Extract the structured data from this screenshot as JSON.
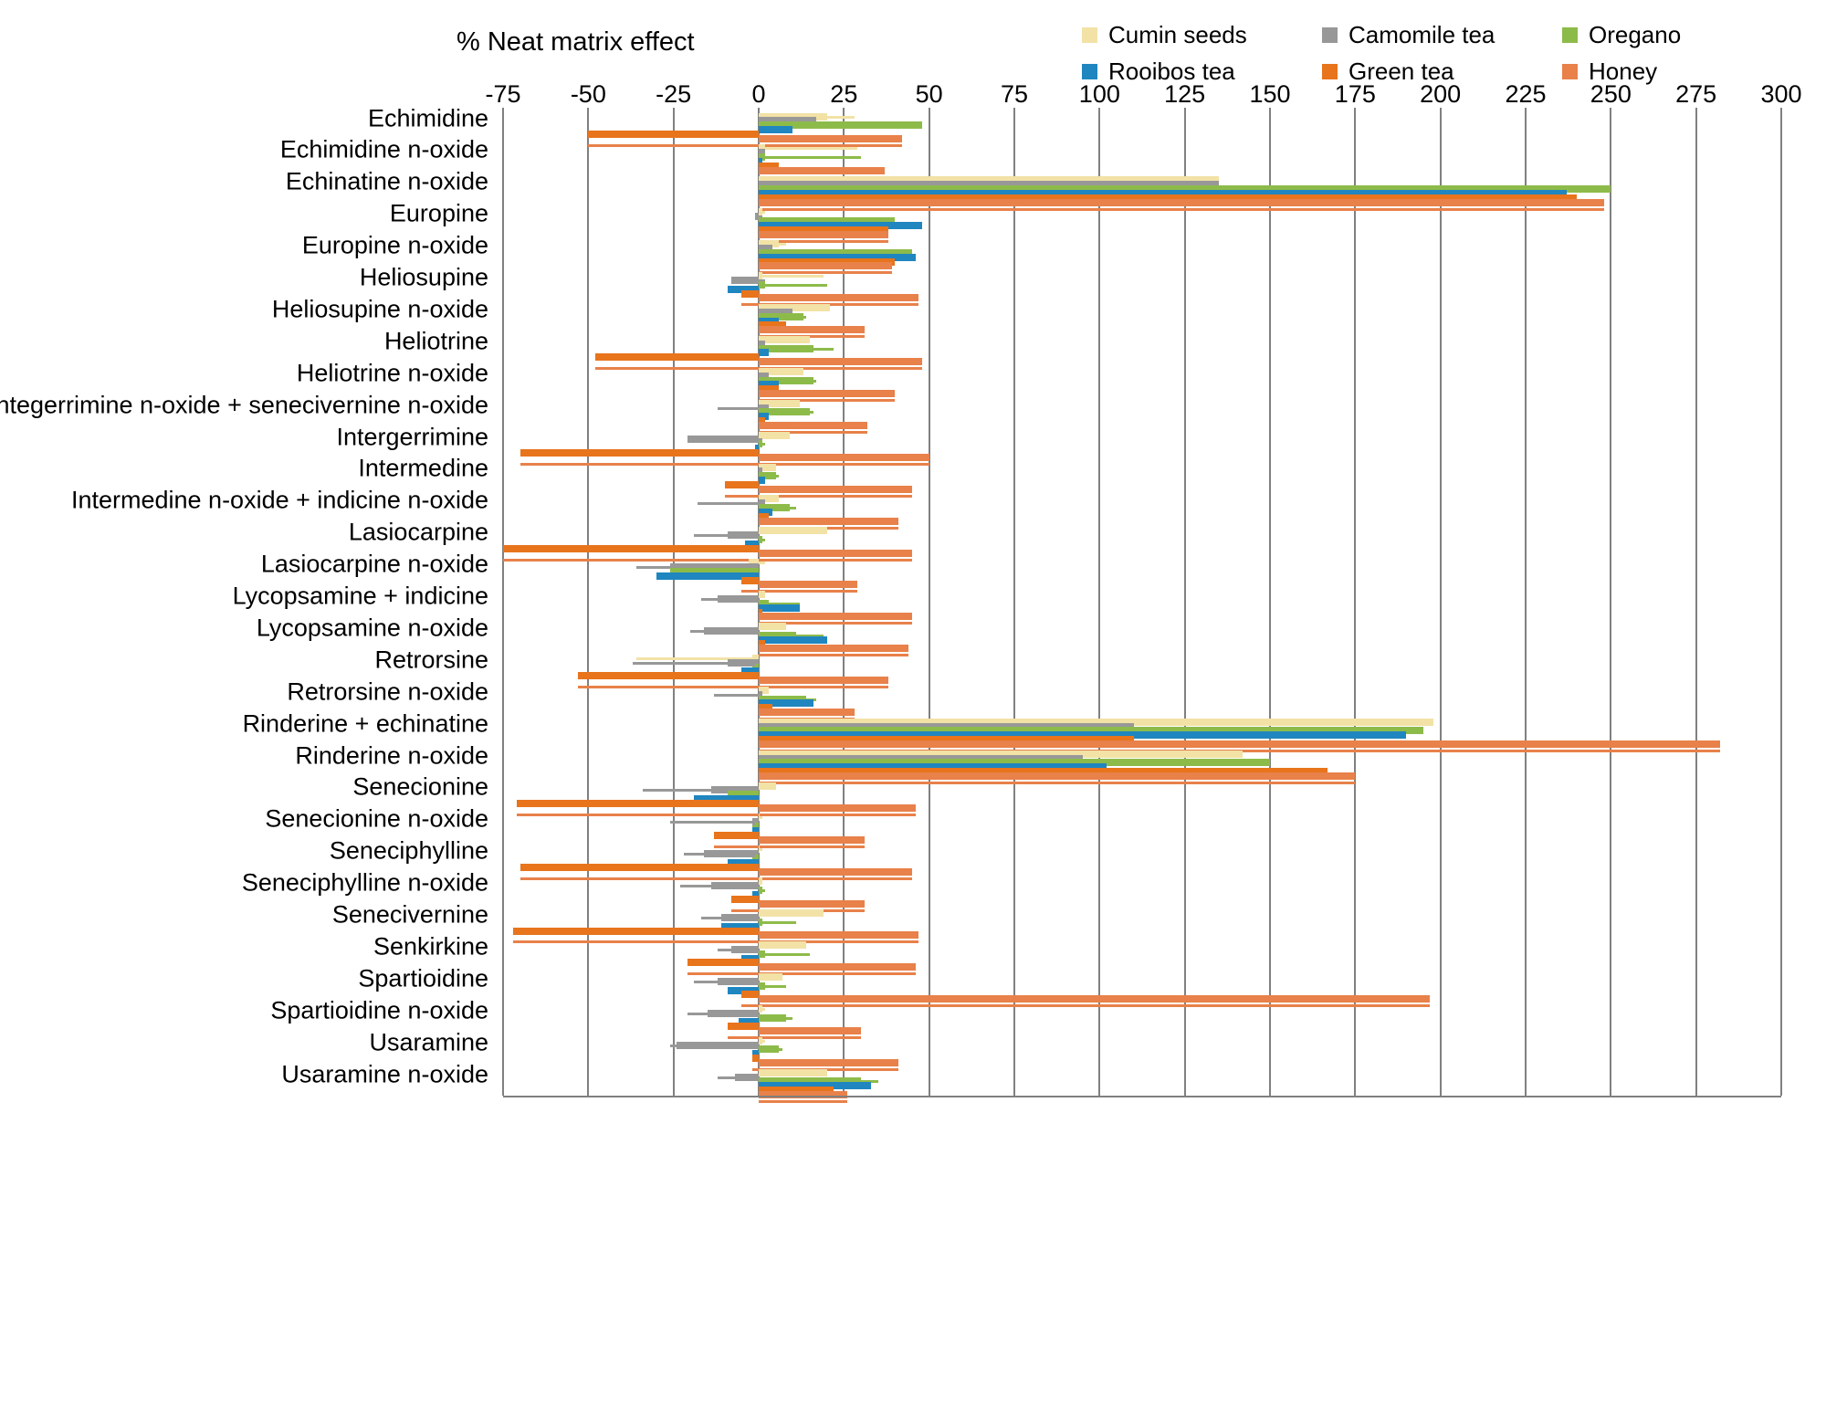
{
  "chart_data": {
    "type": "bar",
    "orientation": "horizontal",
    "title": "% Neat matrix effect",
    "xlabel": "% Neat matrix effect",
    "ylabel": "",
    "xlim": [
      -75,
      300
    ],
    "xticks": [
      -75,
      -50,
      -25,
      0,
      25,
      50,
      75,
      100,
      125,
      150,
      175,
      200,
      225,
      250,
      275,
      300
    ],
    "grid": true,
    "legend_position": "top-right",
    "colors": {
      "Cumin seeds": "#F2E2A6",
      "Camomile tea": "#989898",
      "Oregano": "#8DBB4A",
      "Rooibos tea": "#1F86C0",
      "Green tea": "#E8741C",
      "Honey": "#E8814A"
    },
    "series_names": [
      "Cumin seeds",
      "Camomile tea",
      "Oregano",
      "Rooibos tea",
      "Green tea",
      "Honey"
    ],
    "categories": [
      "Echimidine",
      "Echimidine n-oxide",
      "Echinatine n-oxide",
      "Europine",
      "Europine n-oxide",
      "Heliosupine",
      "Heliosupine n-oxide",
      "Heliotrine",
      "Heliotrine n-oxide",
      "Integerrimine n-oxide + senecivernine n-oxide",
      "Intergerrimine",
      "Intermedine",
      "Intermedine n-oxide + indicine n-oxide",
      "Lasiocarpine",
      "Lasiocarpine n-oxide",
      "Lycopsamine + indicine",
      "Lycopsamine n-oxide",
      "Retrorsine",
      "Retrorsine n-oxide",
      "Rinderine + echinatine",
      "Rinderine n-oxide",
      "Senecionine",
      "Senecionine n-oxide",
      "Seneciphylline",
      "Seneciphylline n-oxide",
      "Senecivernine",
      "Senkirkine",
      "Spartioidine",
      "Spartioidine n-oxide",
      "Usaramine",
      "Usaramine n-oxide"
    ],
    "series": [
      {
        "name": "Cumin seeds",
        "values": [
          20,
          2,
          135,
          1,
          6,
          1,
          21,
          15,
          13,
          12,
          9,
          5,
          6,
          20,
          -3,
          2,
          8,
          -2,
          3,
          198,
          142,
          5,
          0,
          0,
          1,
          19,
          14,
          7,
          1,
          1,
          20
        ],
        "errors": [
          28,
          29,
          95,
          2,
          8,
          19,
          4,
          2,
          3,
          3,
          1,
          2,
          5,
          3,
          2,
          2,
          4,
          -36,
          2,
          5,
          7,
          3,
          1,
          1,
          1,
          2,
          2,
          2,
          2,
          2,
          4
        ]
      },
      {
        "name": "Camomile tea",
        "values": [
          17,
          2,
          135,
          -1,
          4,
          -8,
          10,
          2,
          3,
          3,
          -21,
          1,
          2,
          -9,
          -26,
          -12,
          -16,
          -9,
          1,
          110,
          95,
          -14,
          -2,
          -16,
          -14,
          -11,
          -8,
          -12,
          -15,
          -24,
          -7
        ],
        "errors": [
          1,
          1,
          4,
          1,
          1,
          2,
          1,
          1,
          1,
          -12,
          1,
          1,
          -18,
          -19,
          -36,
          -17,
          -20,
          -37,
          -13,
          3,
          3,
          -34,
          -26,
          -22,
          -23,
          -17,
          -12,
          -19,
          -21,
          -26,
          -12
        ]
      },
      {
        "name": "Oregano",
        "values": [
          48,
          2,
          250,
          40,
          45,
          2,
          13,
          16,
          16,
          15,
          1,
          5,
          9,
          1,
          -26,
          3,
          11,
          -1,
          14,
          195,
          150,
          -9,
          -1,
          -1,
          1,
          1,
          2,
          2,
          8,
          6,
          30
        ],
        "errors": [
          48,
          30,
          250,
          40,
          45,
          20,
          14,
          22,
          17,
          16,
          2,
          6,
          11,
          2,
          -25,
          12,
          19,
          -2,
          17,
          195,
          150,
          -8,
          -2,
          -2,
          2,
          11,
          15,
          8,
          10,
          7,
          35
        ]
      },
      {
        "name": "Rooibos tea",
        "values": [
          10,
          1,
          237,
          48,
          46,
          -9,
          6,
          3,
          6,
          3,
          -1,
          2,
          4,
          -4,
          -30,
          12,
          20,
          -5,
          16,
          190,
          102,
          -19,
          -2,
          -9,
          -2,
          -11,
          -5,
          -9,
          -6,
          -2,
          33
        ]
      },
      {
        "name": "Green tea",
        "values": [
          -50,
          6,
          240,
          38,
          40,
          -5,
          8,
          -48,
          6,
          2,
          -70,
          -10,
          3,
          -75,
          -5,
          1,
          2,
          -53,
          4,
          110,
          167,
          -71,
          -13,
          -70,
          -8,
          -72,
          -21,
          -5,
          -9,
          -2,
          22
        ]
      },
      {
        "name": "Honey",
        "values": [
          42,
          37,
          248,
          38,
          39,
          47,
          31,
          48,
          40,
          32,
          50,
          45,
          41,
          45,
          29,
          45,
          44,
          38,
          28,
          282,
          175,
          46,
          31,
          45,
          31,
          47,
          46,
          197,
          30,
          41,
          26
        ]
      }
    ]
  },
  "legend": {
    "items": [
      {
        "label": "Cumin seeds",
        "color": "#F2E2A6"
      },
      {
        "label": "Camomile tea",
        "color": "#989898"
      },
      {
        "label": "Oregano",
        "color": "#8DBB4A"
      },
      {
        "label": "Rooibos tea",
        "color": "#1F86C0"
      },
      {
        "label": "Green tea",
        "color": "#E8741C"
      },
      {
        "label": "Honey",
        "color": "#E8814A"
      }
    ]
  },
  "axis": {
    "title": "% Neat matrix effect"
  }
}
